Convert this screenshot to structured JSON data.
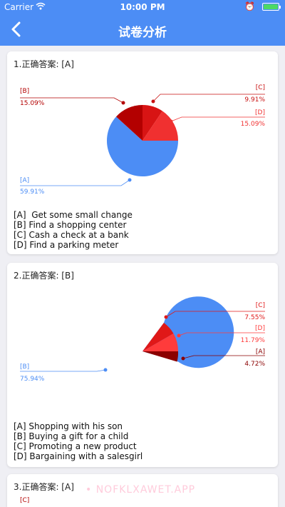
{
  "status_bar": {
    "carrier": "Carrier",
    "time": "10:00 PM"
  },
  "nav": {
    "title": "试卷分析"
  },
  "questions": [
    {
      "heading": "1.正确答案: [A]",
      "options": [
        "[A]  Get some small change",
        "[B] Find a shopping center",
        "[C] Cash a check at a bank",
        "[D] Find a parking meter"
      ],
      "slices": [
        {
          "label": "[A]",
          "value": 59.91,
          "value_text": "59.91%",
          "color": "#4c8df5"
        },
        {
          "label": "[B]",
          "value": 15.09,
          "value_text": "15.09%",
          "color": "#b30000"
        },
        {
          "label": "[C]",
          "value": 9.91,
          "value_text": "9.91%",
          "color": "#d81414"
        },
        {
          "label": "[D]",
          "value": 15.09,
          "value_text": "15.09%",
          "color": "#f03030"
        }
      ]
    },
    {
      "heading": "2.正确答案: [B]",
      "options": [
        "[A] Shopping with his son",
        "[B] Buying a gift for a child",
        "[C] Promoting a new product",
        "[D] Bargaining with a salesgirl"
      ],
      "slices": [
        {
          "label": "[B]",
          "value": 75.94,
          "value_text": "75.94%",
          "color": "#4c8df5"
        },
        {
          "label": "[C]",
          "value": 7.55,
          "value_text": "7.55%",
          "color": "#e01818"
        },
        {
          "label": "[D]",
          "value": 11.79,
          "value_text": "11.79%",
          "color": "#ff3b3b"
        },
        {
          "label": "[A]",
          "value": 4.72,
          "value_text": "4.72%",
          "color": "#8b0000"
        }
      ]
    },
    {
      "heading": "3.正确答案: [A]",
      "partial_label": "[C]"
    }
  ],
  "watermark": "• NOFKLXAWET.APP"
}
